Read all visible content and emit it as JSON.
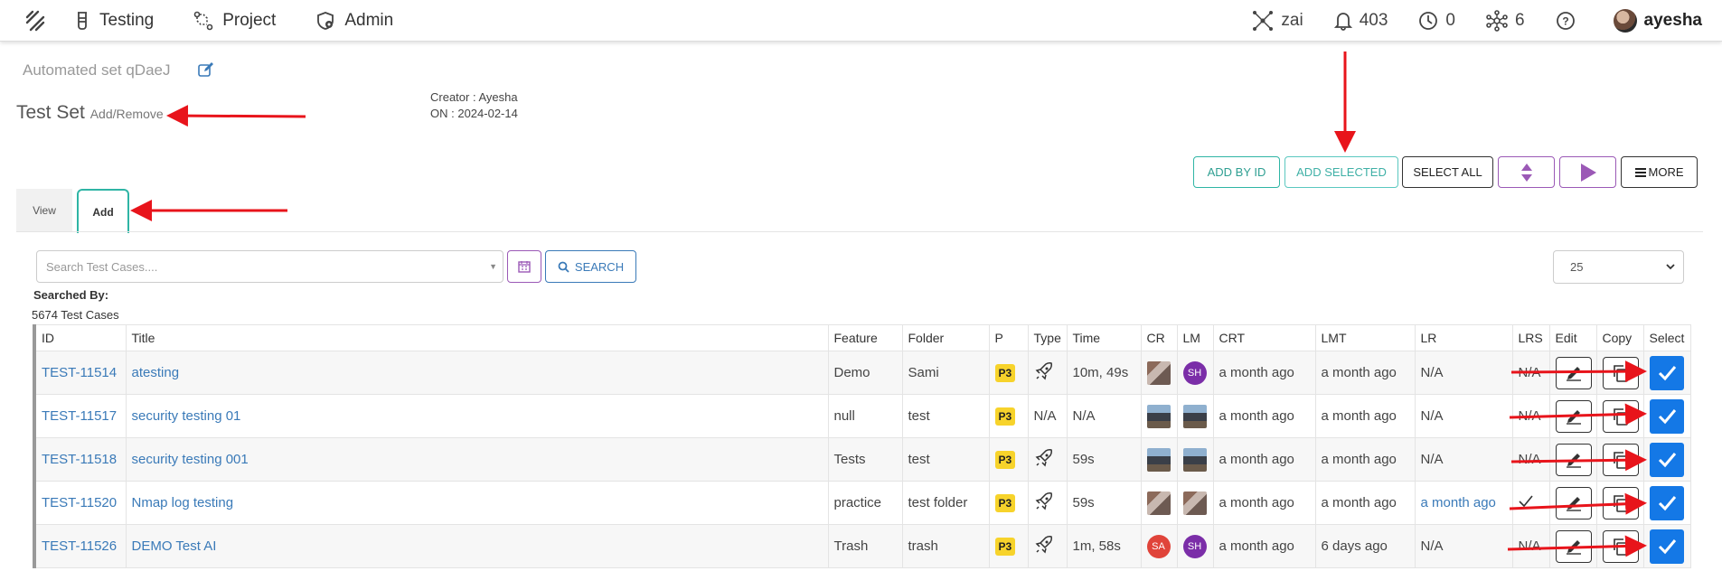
{
  "nav": {
    "items": [
      {
        "label": "Testing",
        "icon": "flask-icon"
      },
      {
        "label": "Project",
        "icon": "project-icon"
      },
      {
        "label": "Admin",
        "icon": "admin-icon"
      }
    ],
    "right": {
      "zai_label": "zai",
      "notifications": "403",
      "pending": "0",
      "network": "6",
      "help": "?",
      "user": "ayesha"
    }
  },
  "header": {
    "set_name": "Automated set qDaeJ",
    "title": "Test Set",
    "subtitle": "Add/Remove",
    "creator": "Creator : Ayesha",
    "created_on": "ON : 2024-02-14"
  },
  "actions": {
    "add_by_id": "ADD BY ID",
    "add_selected": "ADD SELECTED",
    "select_all": "SELECT ALL",
    "more": "MORE"
  },
  "tabs": {
    "view": "View",
    "add": "Add"
  },
  "search": {
    "placeholder": "Search Test Cases....",
    "button": "SEARCH",
    "page_size": "25",
    "searched_by": "Searched By:",
    "count": "5674 Test Cases"
  },
  "table": {
    "headers": [
      "ID",
      "Title",
      "Feature",
      "Folder",
      "P",
      "Type",
      "Time",
      "CR",
      "LM",
      "CRT",
      "LMT",
      "LR",
      "LRS",
      "Edit",
      "Copy",
      "Select"
    ],
    "rows": [
      {
        "id": "TEST-11514",
        "title": "atesting",
        "feature": "Demo",
        "folder": "Sami",
        "p": "P3",
        "type": "rocket",
        "time": "10m, 49s",
        "cr": "cat",
        "lm": "SH",
        "crt": "a month ago",
        "lmt": "a month ago",
        "lr": "N/A",
        "lrs": "N/A"
      },
      {
        "id": "TEST-11517",
        "title": "security testing 01",
        "feature": "null",
        "folder": "test",
        "p": "P3",
        "type": "N/A",
        "time": "N/A",
        "cr": "city",
        "lm": "city",
        "crt": "a month ago",
        "lmt": "a month ago",
        "lr": "N/A",
        "lrs": "N/A"
      },
      {
        "id": "TEST-11518",
        "title": "security testing 001",
        "feature": "Tests",
        "folder": "test",
        "p": "P3",
        "type": "rocket",
        "time": "59s",
        "cr": "city",
        "lm": "city",
        "crt": "a month ago",
        "lmt": "a month ago",
        "lr": "N/A",
        "lrs": "N/A"
      },
      {
        "id": "TEST-11520",
        "title": "Nmap log testing",
        "feature": "practice",
        "folder": "test folder",
        "p": "P3",
        "type": "rocket",
        "time": "59s",
        "cr": "cat",
        "lm": "cat",
        "crt": "a month ago",
        "lmt": "a month ago",
        "lr": "a month ago",
        "lrs": "check"
      },
      {
        "id": "TEST-11526",
        "title": "DEMO Test AI",
        "feature": "Trash",
        "folder": "trash",
        "p": "P3",
        "type": "rocket",
        "time": "1m, 58s",
        "cr": "SA",
        "lm": "SH",
        "crt": "a month ago",
        "lmt": "6 days ago",
        "lr": "N/A",
        "lrs": "N/A"
      }
    ]
  },
  "colors": {
    "teal": "#2fb5a5",
    "purple": "#9b59b6",
    "blue": "#1478e6",
    "link": "#3a7ab8",
    "arrow": "#e8141b",
    "priority": "#f7d32b"
  }
}
